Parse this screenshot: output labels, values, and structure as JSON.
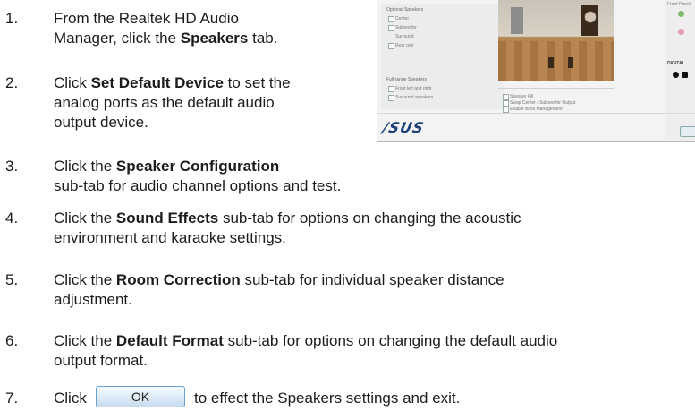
{
  "steps": [
    {
      "num": "1.",
      "lines": [
        [
          "From the Realtek HD Audio"
        ],
        [
          "Manager, click the ",
          {
            "b": "Speakers"
          },
          " tab."
        ]
      ]
    },
    {
      "num": "2.",
      "lines": [
        [
          "Click ",
          {
            "b": "Set Default Device"
          },
          " to set the"
        ],
        [
          "analog ports as the default audio"
        ],
        [
          "output device."
        ]
      ]
    },
    {
      "num": "3.",
      "lines": [
        [
          "Click the ",
          {
            "b": "Speaker Configuration"
          }
        ],
        [
          "sub-tab for audio channel options and test."
        ]
      ]
    },
    {
      "num": "4.",
      "lines": [
        [
          "Click the ",
          {
            "b": "Sound Effects"
          },
          " sub-tab for options on changing the acoustic"
        ],
        [
          "environment and karaoke settings."
        ]
      ]
    },
    {
      "num": "5.",
      "lines": [
        [
          "Click the ",
          {
            "b": "Room Correction"
          },
          " sub-tab for individual speaker distance"
        ],
        [
          "adjustment."
        ]
      ]
    },
    {
      "num": "6.",
      "lines": [
        [
          "Click the ",
          {
            "b": "Default Format"
          },
          " sub-tab for options on changing the default audio"
        ],
        [
          "output format."
        ]
      ]
    }
  ],
  "step7": {
    "num": "7.",
    "before": "Click",
    "button_label": "OK",
    "after": "to effect the Speakers settings and exit."
  },
  "screenshot": {
    "logo_text": "/SUS",
    "left_group_1": "Optional Speakers",
    "left_group_1_items": [
      "Center",
      "Subwoofer",
      "Surround",
      "Rear pair"
    ],
    "left_group_2": "Full-range Speakers",
    "left_group_2_items": [
      "Front left and right",
      "Surround speakers"
    ],
    "bottom_items": [
      "Speaker Fill",
      "Swap Center / Subwoofer Output",
      "Enable Bass Management"
    ],
    "right_label_1": "Front Panel",
    "right_label_2": "DIGITAL"
  }
}
